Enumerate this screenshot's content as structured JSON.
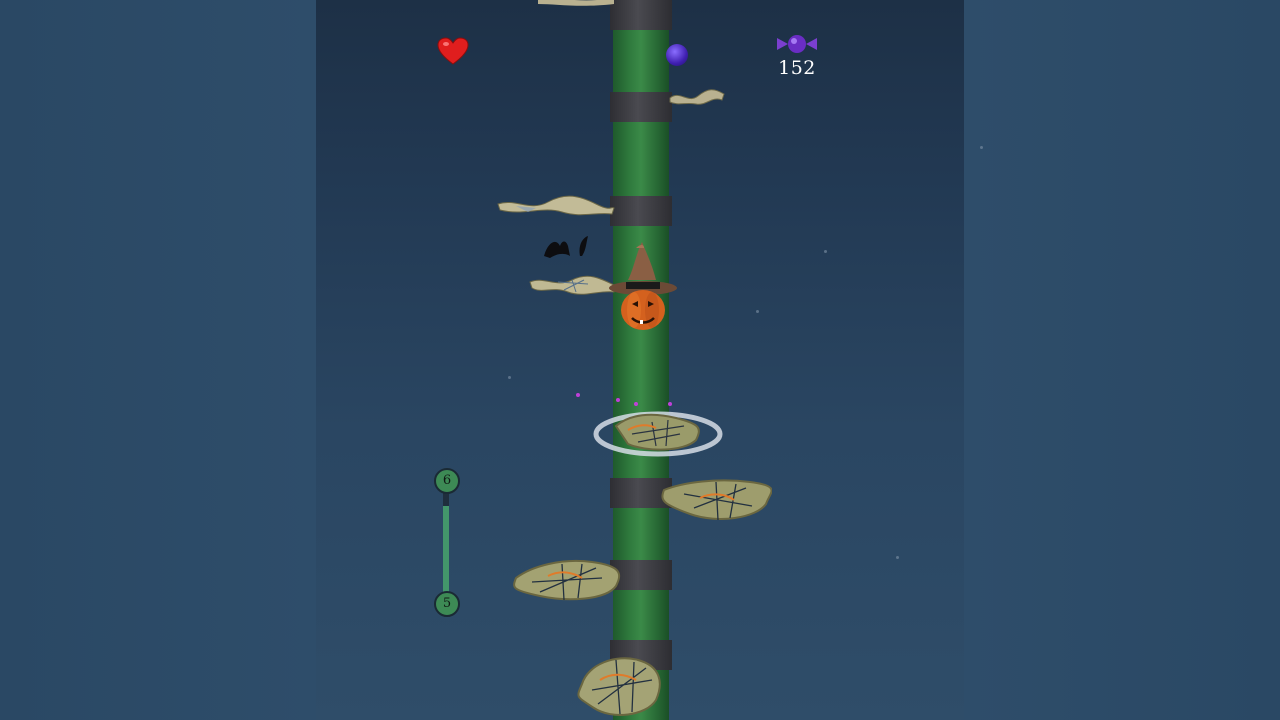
{
  "hud": {
    "lives_icon": "heart-icon",
    "power_icon": "purple-orb-icon",
    "candy_icon": "candy-icon",
    "candy_count": "152"
  },
  "level_progress": {
    "next_level": "6",
    "current_level": "5",
    "progress": 0.85
  },
  "colors": {
    "tower": "#2f7a3d",
    "level_node": "#3d8a55",
    "heart": "#e01e1e",
    "candy": "#7b3fd0"
  }
}
